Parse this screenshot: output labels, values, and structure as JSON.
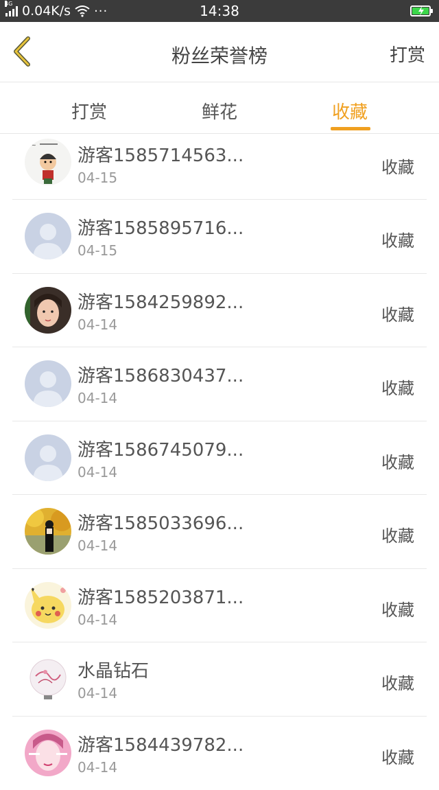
{
  "status_bar": {
    "network_type": "4G",
    "speed": "0.04K/s",
    "more": "···",
    "time": "14:38",
    "battery_color": "#3cd64a"
  },
  "header": {
    "back_icon": "chevron-left-icon",
    "title": "粉丝荣誉榜",
    "right_action": "打赏"
  },
  "tabs": {
    "items": [
      "打赏",
      "鲜花",
      "收藏"
    ],
    "active_index": 2,
    "active_color": "#f0a020"
  },
  "list": {
    "items": [
      {
        "name": "游客1585714563...",
        "date": "04-15",
        "action": "收藏",
        "avatar": "cartoon-boy-avatar"
      },
      {
        "name": "游客1585895716...",
        "date": "04-15",
        "action": "收藏",
        "avatar": "default-avatar"
      },
      {
        "name": "游客1584259892...",
        "date": "04-14",
        "action": "收藏",
        "avatar": "girl-photo-avatar"
      },
      {
        "name": "游客1586830437...",
        "date": "04-14",
        "action": "收藏",
        "avatar": "default-avatar"
      },
      {
        "name": "游客1586745079...",
        "date": "04-14",
        "action": "收藏",
        "avatar": "default-avatar"
      },
      {
        "name": "游客1585033696...",
        "date": "04-14",
        "action": "收藏",
        "avatar": "autumn-photo-avatar"
      },
      {
        "name": "游客1585203871...",
        "date": "04-14",
        "action": "收藏",
        "avatar": "pikachu-avatar"
      },
      {
        "name": "水晶钻石",
        "date": "04-14",
        "action": "收藏",
        "avatar": "crystal-ball-avatar"
      },
      {
        "name": "游客1584439782...",
        "date": "04-14",
        "action": "收藏",
        "avatar": "pink-photo-avatar"
      }
    ]
  }
}
